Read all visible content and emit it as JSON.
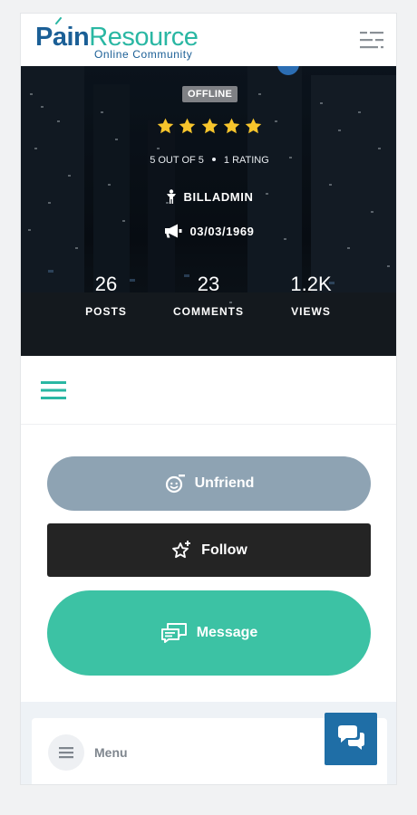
{
  "header": {
    "logo_primary": "Pain",
    "logo_secondary": "Resource",
    "logo_tagline": "Online Community",
    "menu_icon": "menu-lines-icon"
  },
  "profile": {
    "status_badge": "OFFLINE",
    "rating": {
      "value": 5,
      "max": 5,
      "label": "5 OUT OF 5",
      "count_label": "1 RATING"
    },
    "username": "BILLADMIN",
    "username_icon": "person-icon",
    "date": "03/03/1969",
    "date_icon": "megaphone-icon",
    "stats": [
      {
        "value": "26",
        "label": "POSTS"
      },
      {
        "value": "23",
        "label": "COMMENTS"
      },
      {
        "value": "1.2K",
        "label": "VIEWS"
      }
    ]
  },
  "subnav": {
    "icon": "hamburger-icon"
  },
  "actions": {
    "unfriend_label": "Unfriend",
    "follow_label": "Follow",
    "message_label": "Message"
  },
  "bottom_menu": {
    "label": "Menu"
  },
  "colors": {
    "brand_blue": "#1b5f96",
    "brand_teal": "#2ab7a3",
    "star_yellow": "#f7c52c",
    "unfriend_bg": "#8ea3b3",
    "follow_bg": "#242424",
    "message_bg": "#3cc2a4",
    "chat_bg": "#1f6ea6"
  }
}
